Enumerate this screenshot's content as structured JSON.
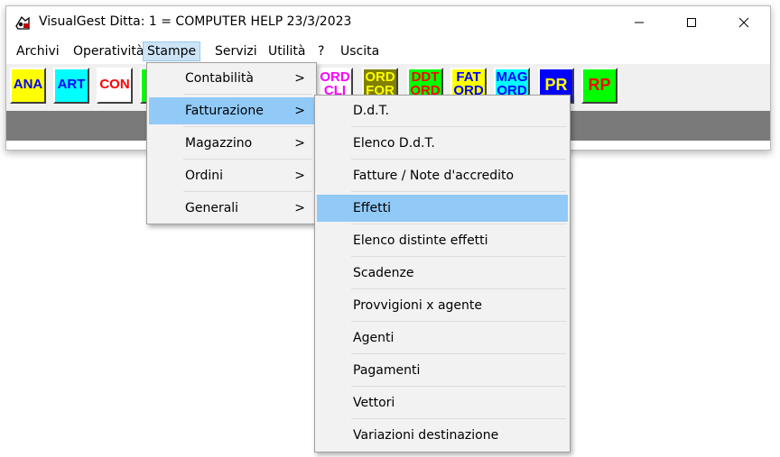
{
  "window": {
    "title": "VisualGest  Ditta: 1 = COMPUTER HELP  23/3/2023",
    "controls": {
      "minimize": "—",
      "maximize": "☐",
      "close": "✕"
    }
  },
  "menubar": [
    {
      "label": "Archivi"
    },
    {
      "label": "Operatività"
    },
    {
      "label": "Stampe",
      "active": true
    },
    {
      "label": "Servizi"
    },
    {
      "label": "Utilità"
    },
    {
      "label": "?"
    },
    {
      "label": "Uscita"
    }
  ],
  "toolbar": [
    {
      "label": "ANA",
      "bg": "#ffff00",
      "fg": "#0000ff"
    },
    {
      "label": "ART",
      "bg": "#00ffff",
      "fg": "#0000ff"
    },
    {
      "label": "CON",
      "bg": "#ffffff",
      "fg": "#ff0000"
    },
    {
      "label": "",
      "bg": "#00ff00",
      "fg": "#000000"
    },
    {
      "label": "ORD CLI",
      "bg": "#ffffff",
      "fg": "#ff00ff"
    },
    {
      "label": "ORD FOR",
      "bg": "#808000",
      "fg": "#ffff00"
    },
    {
      "label": "DDT ORD",
      "bg": "#00ff00",
      "fg": "#ff0000"
    },
    {
      "label": "FAT ORD",
      "bg": "#ffff00",
      "fg": "#0000ff"
    },
    {
      "label": "MAG ORD",
      "bg": "#00ffff",
      "fg": "#0000ff"
    },
    {
      "label": "PR",
      "bg": "#0000ff",
      "fg": "#ffff00"
    },
    {
      "label": "RP",
      "bg": "#00ff00",
      "fg": "#ff0000"
    }
  ],
  "stampe_menu": [
    {
      "label": "Contabilità",
      "submenu_arrow": ">"
    },
    {
      "label": "Fatturazione",
      "submenu_arrow": ">",
      "highlighted": true
    },
    {
      "label": "Magazzino",
      "submenu_arrow": ">"
    },
    {
      "label": "Ordini",
      "submenu_arrow": ">"
    },
    {
      "label": "Generali",
      "submenu_arrow": ">"
    }
  ],
  "fatturazione_menu": [
    {
      "label": "D.d.T."
    },
    {
      "label": "Elenco D.d.T."
    },
    {
      "label": "Fatture / Note d'accredito"
    },
    {
      "label": "Effetti",
      "highlighted": true
    },
    {
      "label": "Elenco distinte effetti"
    },
    {
      "label": "Scadenze"
    },
    {
      "label": "Provvigioni x agente"
    },
    {
      "label": "Agenti"
    },
    {
      "label": "Pagamenti"
    },
    {
      "label": "Vettori"
    },
    {
      "label": "Variazioni destinazione"
    }
  ]
}
